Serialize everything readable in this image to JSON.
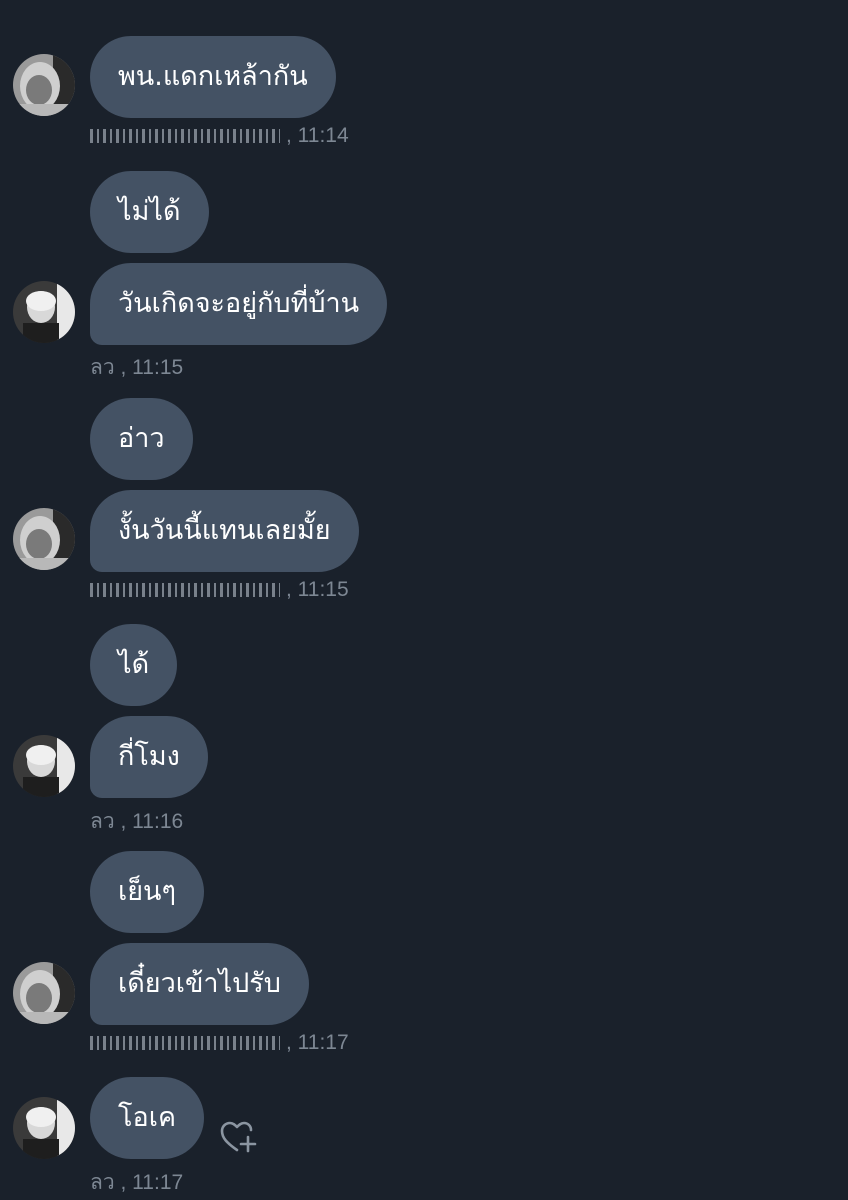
{
  "messages": [
    {
      "text": "พน.แดกเหล้ากัน"
    },
    {
      "text": "ไม่ได้"
    },
    {
      "text": "วันเกิดจะอยู่กับที่บ้าน"
    },
    {
      "text": "อ่าว"
    },
    {
      "text": "งั้นวันนี้แทนเลยมั้ย"
    },
    {
      "text": "ได้"
    },
    {
      "text": "กี่โมง"
    },
    {
      "text": "เย็นๆ"
    },
    {
      "text": "เดี๋ยวเข้าไปรับ"
    },
    {
      "text": "โอเค"
    }
  ],
  "meta": [
    {
      "sender": "",
      "time": ", 11:14"
    },
    {
      "sender": "ลว",
      "time": ", 11:15"
    },
    {
      "sender": "",
      "time": ", 11:15"
    },
    {
      "sender": "ลว",
      "time": ", 11:16"
    },
    {
      "sender": "",
      "time": ", 11:17"
    },
    {
      "sender": "ลว",
      "time": ", 11:17"
    }
  ],
  "colors": {
    "background": "#1a212b",
    "bubble": "#445264",
    "meta_text": "#7d8793"
  },
  "icons": {
    "react": "heart-plus-icon",
    "avatar_a": "avatar-hooded-person",
    "avatar_b": "avatar-blond-person"
  }
}
